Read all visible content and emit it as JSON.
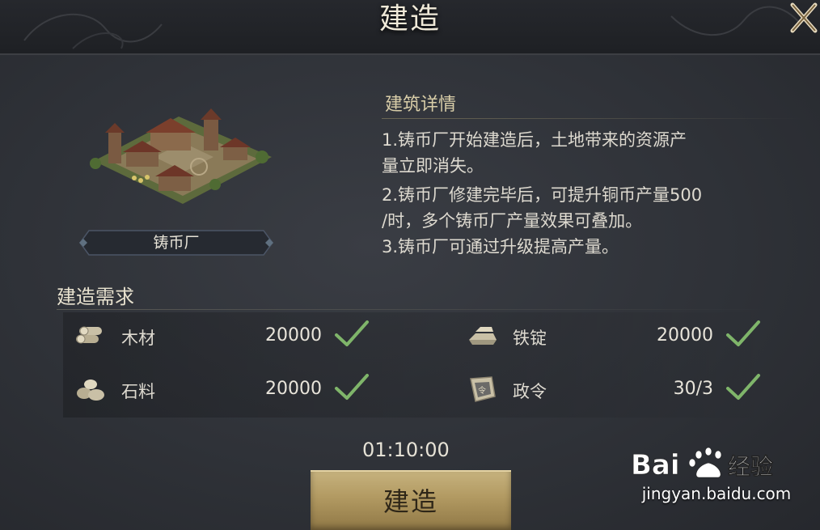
{
  "header": {
    "title": "建造"
  },
  "building": {
    "name": "铸币厂"
  },
  "details": {
    "title": "建筑详情",
    "lines": [
      "1.铸币厂开始建造后，土地带来的资源产",
      "量立即消失。",
      "2.铸币厂修建完毕后，可提升铜币产量500",
      "/时，多个铸币厂产量效果可叠加。",
      "3.铸币厂可通过升级提高产量。"
    ]
  },
  "requirements": {
    "title": "建造需求",
    "items": [
      {
        "name": "木材",
        "amount": "20000",
        "icon": "wood-icon",
        "met": true
      },
      {
        "name": "铁锭",
        "amount": "20000",
        "icon": "iron-ingot-icon",
        "met": true
      },
      {
        "name": "石料",
        "amount": "20000",
        "icon": "stone-icon",
        "met": true
      },
      {
        "name": "政令",
        "amount": "30/3",
        "icon": "decree-icon",
        "met": true
      }
    ]
  },
  "timer": "01:10:00",
  "build_button": "建造",
  "watermark": {
    "text": "jingyan.baidu.com",
    "logo": "Bai  经验"
  },
  "colors": {
    "check": "#7fb56a",
    "button": "#b29a62",
    "accent": "#d8cda8"
  }
}
